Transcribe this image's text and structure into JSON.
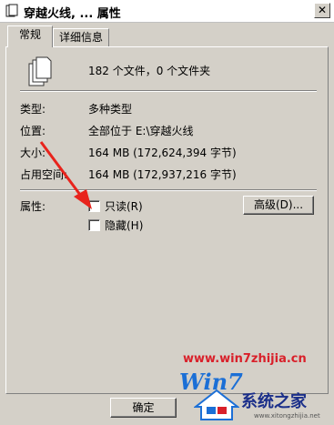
{
  "window": {
    "title": "穿越火线, ... 属性",
    "close_label": "✕"
  },
  "tabs": [
    {
      "label": "常规",
      "active": true
    },
    {
      "label": "详细信息",
      "active": false
    }
  ],
  "summary": {
    "file_count_text": "182 个文件，0 个文件夹"
  },
  "properties": [
    {
      "label": "类型:",
      "value": "多种类型"
    },
    {
      "label": "位置:",
      "value": "全部位于 E:\\穿越火线"
    },
    {
      "label": "大小:",
      "value": "164 MB (172,624,394 字节)"
    },
    {
      "label": "占用空间:",
      "value": "164 MB (172,937,216 字节)"
    }
  ],
  "attributes": {
    "label": "属性:",
    "readonly_label": "只读(R)",
    "readonly_checked": false,
    "hidden_label": "隐藏(H)",
    "hidden_checked": false,
    "advanced_button": "高级(D)..."
  },
  "footer": {
    "ok_button": "确定"
  },
  "watermark": {
    "site": "www.win7zhijia.cn",
    "logo_text": "Win7",
    "brand": "系统之家",
    "url_small": "www.xitongzhijia.net"
  },
  "colors": {
    "window_bg": "#d4d0c8",
    "arrow": "#e8231c",
    "watermark_red": "#d9202a",
    "watermark_blue": "#1b6fd6"
  }
}
